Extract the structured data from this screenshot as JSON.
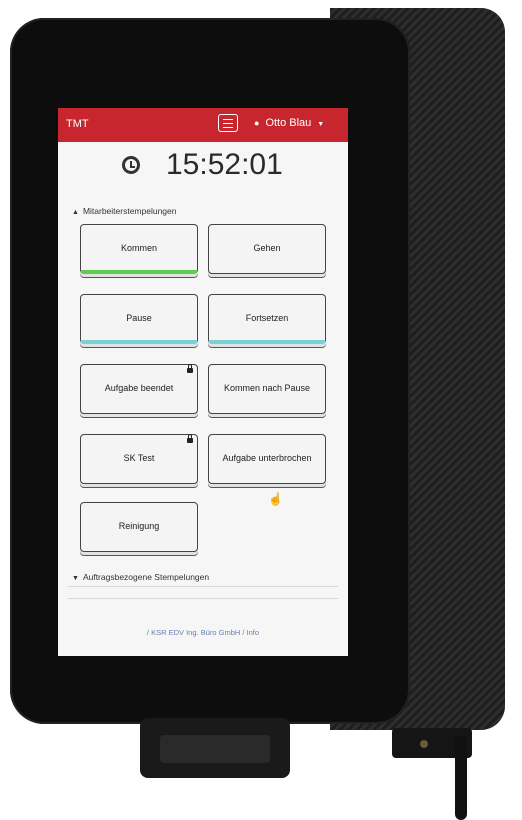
{
  "header": {
    "app_title": "TMT",
    "user_name": "Otto Blau",
    "menu_icon": "hamburger-menu-icon",
    "user_icon": "user-icon"
  },
  "clock": {
    "time": "15:52:01",
    "icon": "clock-icon"
  },
  "sections": {
    "employee": {
      "title": "Mitarbeiterstempelungen",
      "buttons": [
        {
          "label": "Kommen",
          "accent": "#5ccd4e"
        },
        {
          "label": "Gehen"
        },
        {
          "label": "Pause",
          "accent": "#79d2d8"
        },
        {
          "label": "Fortsetzen",
          "accent": "#79d2d8"
        },
        {
          "label": "Aufgabe beendet",
          "icon": "lock-icon"
        },
        {
          "label": "Kommen nach Pause"
        },
        {
          "label": "SK Test",
          "icon": "lock-icon"
        },
        {
          "label": "Aufgabe unterbrochen"
        },
        {
          "label": "Reinigung"
        }
      ]
    },
    "order": {
      "title": "Auftragsbezogene Stempelungen"
    }
  },
  "footer": {
    "text": "/ KSR EDV Ing. Büro GmbH / Info"
  },
  "colors": {
    "header_bg": "#c8262e",
    "screen_bg": "#f6f6f6"
  }
}
